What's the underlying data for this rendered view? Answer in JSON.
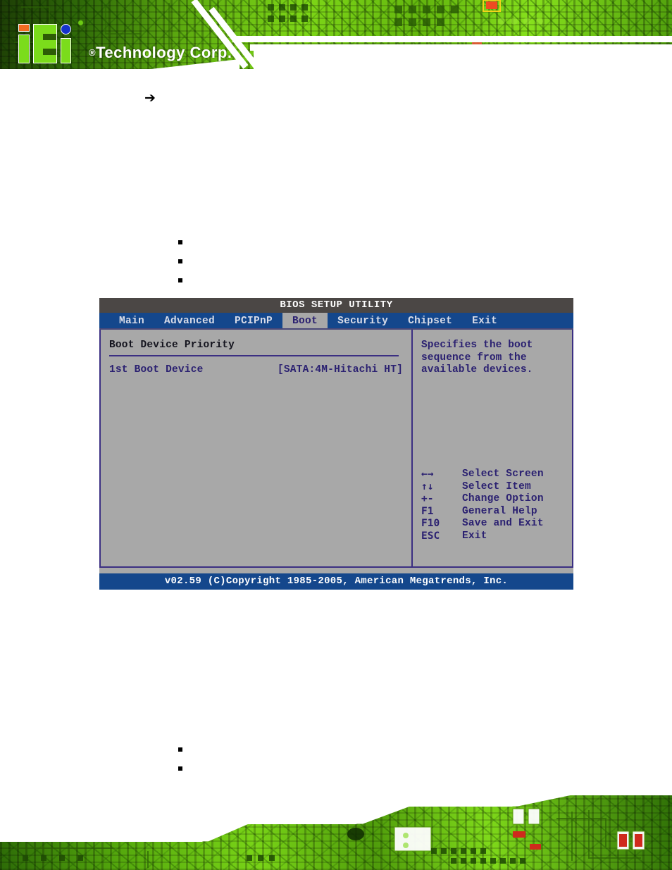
{
  "page": {
    "brand": {
      "logo_mark": "iEi",
      "logo_text": "Technology Corp.",
      "registered_mark": "®"
    },
    "doc_arrow": "➔",
    "bullets_top": [
      "",
      "",
      ""
    ],
    "bullets_bottom": [
      "",
      ""
    ]
  },
  "bios": {
    "title": "BIOS SETUP UTILITY",
    "menu": [
      {
        "label": "Main",
        "active": false
      },
      {
        "label": "Advanced",
        "active": false
      },
      {
        "label": "PCIPnP",
        "active": false
      },
      {
        "label": "Boot",
        "active": true
      },
      {
        "label": "Security",
        "active": false
      },
      {
        "label": "Chipset",
        "active": false
      },
      {
        "label": "Exit",
        "active": false
      }
    ],
    "section_title": "Boot Device Priority",
    "options": [
      {
        "label": "1st Boot Device",
        "value": "[SATA:4M-Hitachi HT]"
      }
    ],
    "help": "Specifies the boot sequence from the available devices.",
    "nav_keys": [
      {
        "key": "←→",
        "desc": "Select Screen"
      },
      {
        "key": "↑↓",
        "desc": "Select Item"
      },
      {
        "key": "+-",
        "desc": "Change Option"
      },
      {
        "key": "F1",
        "desc": "General Help"
      },
      {
        "key": "F10",
        "desc": "Save and Exit"
      },
      {
        "key": "ESC",
        "desc": "Exit"
      }
    ],
    "footer": "v02.59 (C)Copyright 1985-2005, American Megatrends, Inc."
  },
  "colors": {
    "menubar_blue": "#14478c",
    "titlebar_gray": "#4b4745",
    "panel_gray": "#a8a8a8",
    "border_purple": "#3b2f82",
    "text_purple": "#2b2171",
    "pcb_green": "#7bdc1b",
    "logo_orange": "#f26b21",
    "logo_blue": "#1533cc"
  }
}
